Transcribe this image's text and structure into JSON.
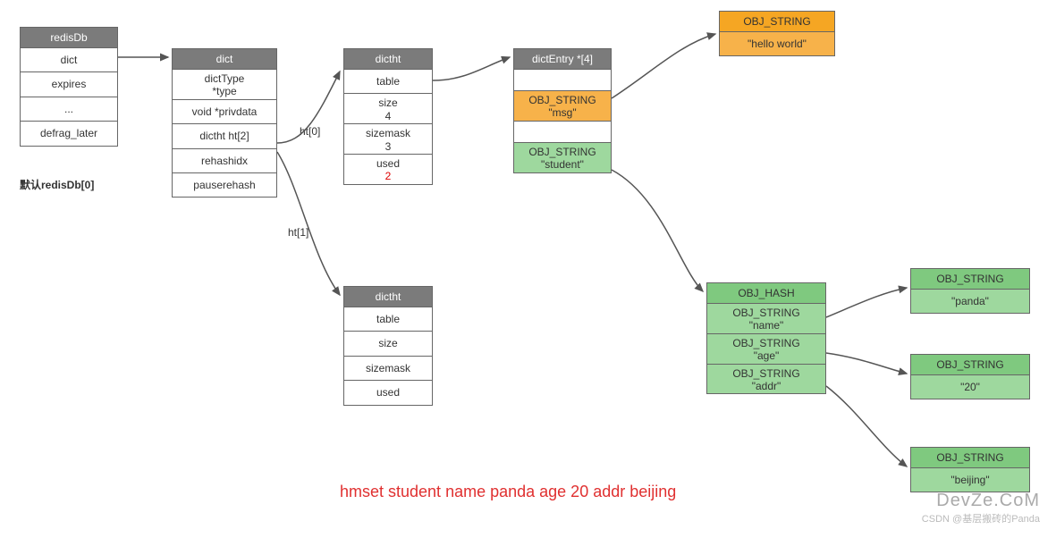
{
  "redisDb": {
    "title": "redisDb",
    "rows": [
      "dict",
      "expires",
      "...",
      "defrag_later"
    ],
    "caption": "默认redisDb[0]"
  },
  "dict": {
    "title": "dict",
    "rows": [
      "dictType\n*type",
      "void *privdata",
      "dictht ht[2]",
      "rehashidx",
      "pauserehash"
    ]
  },
  "dictht0": {
    "title": "dictht",
    "rows": [
      {
        "label": "table"
      },
      {
        "label": "size",
        "value": "4"
      },
      {
        "label": "sizemask",
        "value": "3"
      },
      {
        "label": "used",
        "value": "2",
        "red": true
      }
    ]
  },
  "dictht1": {
    "title": "dictht",
    "rows": [
      "table",
      "size",
      "sizemask",
      "used"
    ]
  },
  "htLabels": {
    "ht0": "ht[0]",
    "ht1": "ht[1]"
  },
  "dictEntry": {
    "title": "dictEntry *[4]",
    "rows": [
      {
        "text": "",
        "class": ""
      },
      {
        "text": "OBJ_STRING\n\"msg\"",
        "class": "orange"
      },
      {
        "text": "",
        "class": ""
      },
      {
        "text": "OBJ_STRING\n\"student\"",
        "class": "green"
      }
    ]
  },
  "obj_helloworld": {
    "header": "OBJ_STRING",
    "value": "\"hello world\""
  },
  "obj_hash": {
    "header": "OBJ_HASH",
    "rows": [
      "OBJ_STRING\n\"name\"",
      "OBJ_STRING\n\"age\"",
      "OBJ_STRING\n\"addr\""
    ]
  },
  "obj_panda": {
    "header": "OBJ_STRING",
    "value": "\"panda\""
  },
  "obj_20": {
    "header": "OBJ_STRING",
    "value": "\"20\""
  },
  "obj_beijing": {
    "header": "OBJ_STRING",
    "value": "\"beijing\""
  },
  "command": "hmset student name panda age 20 addr beijing",
  "watermark": {
    "main": "DevZe.CoM",
    "sub": "CSDN @基层搬砖的Panda"
  }
}
